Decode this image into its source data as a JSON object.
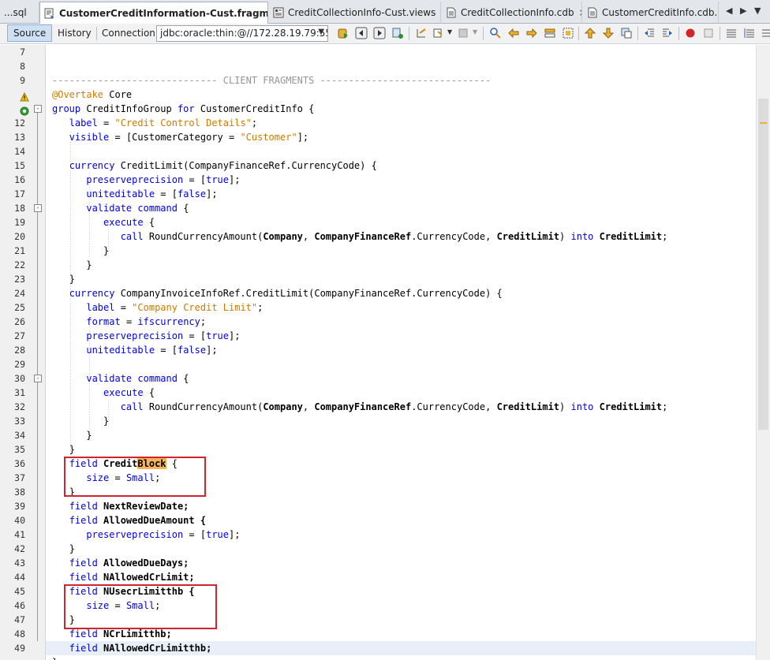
{
  "tabs": [
    {
      "label": "...sql",
      "icon": "sql-file-icon",
      "active": false,
      "closable": false
    },
    {
      "label": "CustomerCreditInformation-Cust.fragment",
      "icon": "fragment-file-icon",
      "active": true,
      "closable": true
    },
    {
      "label": "CreditCollectionInfo-Cust.views",
      "icon": "views-file-icon",
      "active": false,
      "closable": true
    },
    {
      "label": "CreditCollectionInfo.cdb",
      "icon": "cdb-file-icon",
      "active": false,
      "closable": true
    },
    {
      "label": "CustomerCreditInfo.cdb...",
      "icon": "cdb-file-icon",
      "active": false,
      "closable": false
    }
  ],
  "tab_close": "×",
  "tab_nav": {
    "prev": "◀",
    "next": "▶",
    "menu": "▼",
    "maximize": "❐"
  },
  "toolbar": {
    "source_label": "Source",
    "history_label": "History",
    "connection_label": "Connection:",
    "connection_value": "jdbc:oracle:thin:@//172.28.19.79:55...",
    "dropdown_arrow": "⌵"
  },
  "editor": {
    "line_numbers": [
      "7",
      "8",
      "9",
      "",
      "",
      "12",
      "13",
      "14",
      "15",
      "16",
      "17",
      "18",
      "19",
      "20",
      "21",
      "22",
      "23",
      "24",
      "25",
      "26",
      "27",
      "28",
      "29",
      "30",
      "31",
      "32",
      "33",
      "34",
      "35",
      "36",
      "37",
      "38",
      "39",
      "40",
      "41",
      "42",
      "43",
      "44",
      "45",
      "46",
      "47",
      "48",
      "49"
    ],
    "fold_markers": {
      "line_11": "-",
      "line_18": "-",
      "line_30": "-"
    },
    "lines": {
      "l9_comment": "----------------------------- CLIENT FRAGMENTS ------------------------------",
      "l10_annotation": "@Overtake",
      "l10_rest": " Core",
      "l11_kw1": "group",
      "l11_rest1": " CreditInfoGroup ",
      "l11_kw2": "for",
      "l11_rest2": " CustomerCreditInfo {",
      "l12_kw": "label",
      "l12_eq": " = ",
      "l12_str": "\"Credit Control Details\"",
      "l12_end": ";",
      "l13_kw": "visible",
      "l13_rest": " = [CustomerCategory = ",
      "l13_str": "\"Customer\"",
      "l13_end": "];",
      "l15_kw": "currency",
      "l15_rest": " CreditLimit(CompanyFinanceRef.CurrencyCode) {",
      "l16_kw": "preserveprecision",
      "l16_rest1": " = [",
      "l16_val": "true",
      "l16_end": "];",
      "l17_kw": "uniteditable",
      "l17_rest1": " = [",
      "l17_val": "false",
      "l17_end": "];",
      "l18_kw1": "validate",
      "l18_kw2": "command",
      "l18_end": " {",
      "l19_kw": "execute",
      "l19_end": " {",
      "l20_kw": "call",
      "l20_fn": " RoundCurrencyAmount(",
      "l20_b1": "Company",
      "l20_s1": ", ",
      "l20_b2": "CompanyFinanceRef",
      "l20_s2": ".CurrencyCode, ",
      "l20_b3": "CreditLimit",
      "l20_s3": ") ",
      "l20_kw2": "into",
      "l20_s4": " ",
      "l20_b4": "CreditLimit",
      "l20_end": ";",
      "close_brace": "}",
      "l24_kw": "currency",
      "l24_rest": " CompanyInvoiceInfoRef.CreditLimit(CompanyFinanceRef.CurrencyCode) {",
      "l25_kw": "label",
      "l25_eq": " = ",
      "l25_str": "\"Company Credit Limit\"",
      "l25_end": ";",
      "l26_kw": "format",
      "l26_eq": " = ",
      "l26_val": "ifscurrency",
      "l26_end": ";",
      "l36_kw": "field",
      "l36_name1": " Credit",
      "l36_name2": "Block",
      "l36_end": " {",
      "l37_kw": "size",
      "l37_eq": " = ",
      "l37_val": "Small",
      "l37_end": ";",
      "l39_kw": "field",
      "l39_rest": " NextReviewDate;",
      "l40_kw": "field",
      "l40_rest": " AllowedDueAmount {",
      "l43_kw": "field",
      "l43_rest": " AllowedDueDays;",
      "l44_kw": "field",
      "l44_rest": " NAllowedCrLimit;",
      "l45_kw": "field",
      "l45_rest": " NUsecrLimitthb {",
      "l48_kw": "field",
      "l48_rest": " NCrLimitthb;",
      "l49_kw": "field",
      "l49_rest": " NAllowedCrLimitthb;"
    }
  },
  "colors": {
    "keyword": "#0000e6",
    "string": "#ce7b00",
    "comment": "#969696",
    "highlight": "#f5b35b",
    "annotation_box": "#d0262b"
  }
}
